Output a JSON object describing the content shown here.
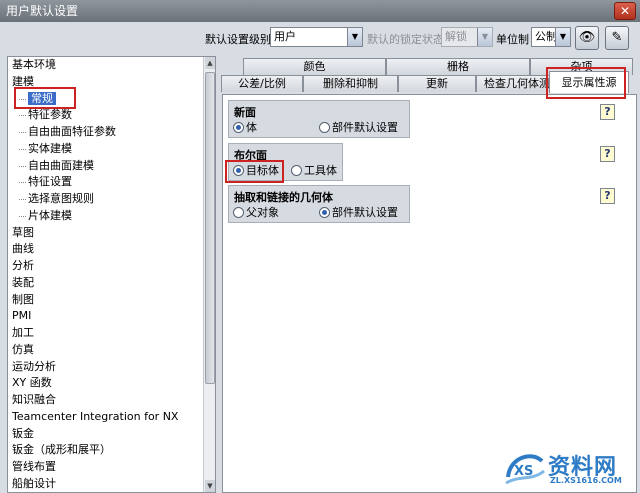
{
  "window": {
    "title": "用户默认设置",
    "close_label": "✕"
  },
  "toolbar": {
    "level_label": "默认设置级别",
    "level_value": "用户",
    "lock_label": "默认的锁定状态",
    "lock_value": "解锁",
    "unit_label": "单位制",
    "unit_value": "公制",
    "btn1_icon": "eye-icon",
    "btn2_icon": "pen-icon"
  },
  "tree": {
    "items": [
      {
        "label": "基本环境",
        "child": false
      },
      {
        "label": "建模",
        "child": false
      },
      {
        "label": "常规",
        "child": true,
        "selected": true
      },
      {
        "label": "特征参数",
        "child": true
      },
      {
        "label": "自由曲面特征参数",
        "child": true
      },
      {
        "label": "实体建模",
        "child": true
      },
      {
        "label": "自由曲面建模",
        "child": true
      },
      {
        "label": "特征设置",
        "child": true
      },
      {
        "label": "选择意图规则",
        "child": true
      },
      {
        "label": "片体建模",
        "child": true
      },
      {
        "label": "草图",
        "child": false
      },
      {
        "label": "曲线",
        "child": false
      },
      {
        "label": "分析",
        "child": false
      },
      {
        "label": "装配",
        "child": false
      },
      {
        "label": "制图",
        "child": false
      },
      {
        "label": "PMI",
        "child": false
      },
      {
        "label": "加工",
        "child": false
      },
      {
        "label": "仿真",
        "child": false
      },
      {
        "label": "运动分析",
        "child": false
      },
      {
        "label": "XY 函数",
        "child": false
      },
      {
        "label": "知识融合",
        "child": false
      },
      {
        "label": "Teamcenter Integration for NX",
        "child": false
      },
      {
        "label": "钣金",
        "child": false
      },
      {
        "label": "钣金（成形和展平）",
        "child": false
      },
      {
        "label": "管线布置",
        "child": false
      },
      {
        "label": "船舶设计",
        "child": false
      }
    ]
  },
  "tabs": {
    "row1": [
      "颜色",
      "栅格",
      "杂项"
    ],
    "row2": [
      "公差/比例",
      "删除和抑制",
      "更新",
      "检查几何体测试",
      "显示属性源"
    ],
    "active": "显示属性源"
  },
  "groups": {
    "new_face": {
      "title": "新面",
      "opt1": "体",
      "opt2": "部件默认设置",
      "selected": 1
    },
    "boolean_face": {
      "title": "布尔面",
      "opt1": "目标体",
      "opt2": "工具体",
      "selected": 1
    },
    "extract_geom": {
      "title": "抽取和链接的几何体",
      "opt1": "父对象",
      "opt2": "部件默认设置",
      "selected": 2
    },
    "help_label": "?"
  },
  "watermark": {
    "text": "资料网",
    "url": "ZL.XS1616.COM"
  },
  "colors": {
    "selection": "#3a6cc8",
    "highlight": "#cc2222",
    "watermark": "#2e7bc6"
  }
}
